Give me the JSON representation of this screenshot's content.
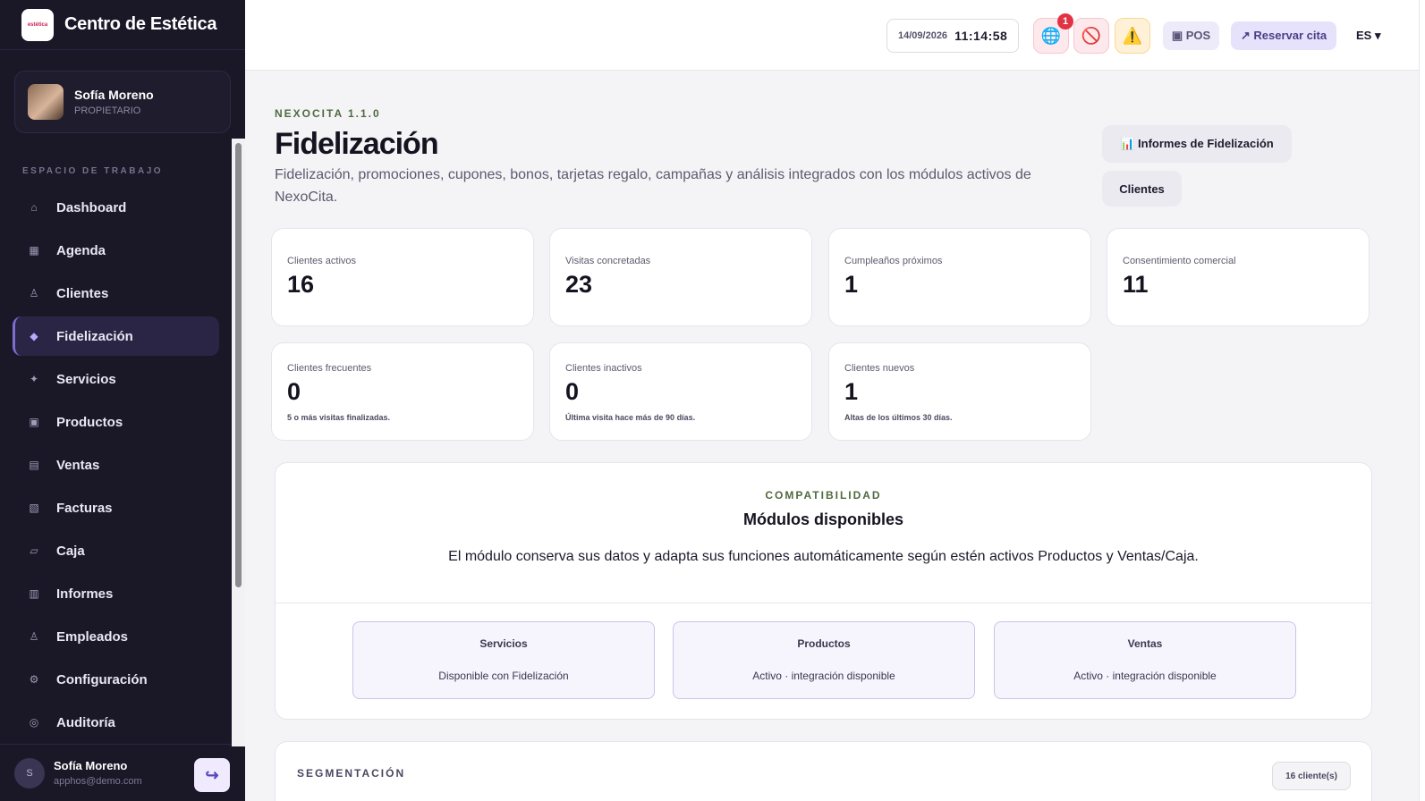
{
  "brand": {
    "name": "Centro de Estética",
    "logo_text": "estética"
  },
  "profile": {
    "name": "Sofía Moreno",
    "role": "PROPIETARIO"
  },
  "sidebar": {
    "section_label": "ESPACIO DE TRABAJO",
    "items": [
      {
        "label": "Dashboard",
        "icon": "⌂"
      },
      {
        "label": "Agenda",
        "icon": "▦"
      },
      {
        "label": "Clientes",
        "icon": "♙"
      },
      {
        "label": "Fidelización",
        "icon": "◆"
      },
      {
        "label": "Servicios",
        "icon": "✦"
      },
      {
        "label": "Productos",
        "icon": "▣"
      },
      {
        "label": "Ventas",
        "icon": "▤"
      },
      {
        "label": "Facturas",
        "icon": "▧"
      },
      {
        "label": "Caja",
        "icon": "▱"
      },
      {
        "label": "Informes",
        "icon": "▥"
      },
      {
        "label": "Empleados",
        "icon": "♙"
      },
      {
        "label": "Configuración",
        "icon": "⚙"
      },
      {
        "label": "Auditoría",
        "icon": "◎"
      }
    ],
    "active_index": 3
  },
  "user_footer": {
    "initial": "S",
    "name": "Sofía Moreno",
    "email": "apphos@demo.com",
    "logout_icon": "↪"
  },
  "topbar": {
    "date": "14/09/2026",
    "time": "11:14:58",
    "notification_count": "1",
    "globe_icon": "🌐",
    "block_icon": "🚫",
    "warning_icon": "⚠️",
    "pos_label": "▣ POS",
    "book_label": "↗ Reservar cita",
    "language": "ES ▾"
  },
  "header": {
    "version": "NEXOCITA 1.1.0",
    "title": "Fidelización",
    "description": "Fidelización, promociones, cupones, bonos, tarjetas regalo, campañas y análisis integrados con los módulos activos de NexoCita.",
    "reports_button": "📊 Informes de Fidelización",
    "clients_button": "Clientes"
  },
  "stats": [
    {
      "label": "Clientes activos",
      "value": "16",
      "note": ""
    },
    {
      "label": "Visitas concretadas",
      "value": "23",
      "note": ""
    },
    {
      "label": "Cumpleaños próximos",
      "value": "1",
      "note": ""
    },
    {
      "label": "Consentimiento comercial",
      "value": "11",
      "note": ""
    },
    {
      "label": "Clientes frecuentes",
      "value": "0",
      "note": "5 o más visitas finalizadas."
    },
    {
      "label": "Clientes inactivos",
      "value": "0",
      "note": "Última visita hace más de 90 días."
    },
    {
      "label": "Clientes nuevos",
      "value": "1",
      "note": "Altas de los últimos 30 días."
    }
  ],
  "compatibility": {
    "eyebrow": "COMPATIBILIDAD",
    "title": "Módulos disponibles",
    "description": "El módulo conserva sus datos y adapta sus funciones automáticamente según estén activos Productos y Ventas/Caja.",
    "modules": [
      {
        "name": "Servicios",
        "status": "Disponible con Fidelización"
      },
      {
        "name": "Productos",
        "status": "Activo · integración disponible"
      },
      {
        "name": "Ventas",
        "status": "Activo · integración disponible"
      }
    ]
  },
  "segmentation": {
    "title": "SEGMENTACIÓN",
    "count": "16 cliente(s)"
  }
}
